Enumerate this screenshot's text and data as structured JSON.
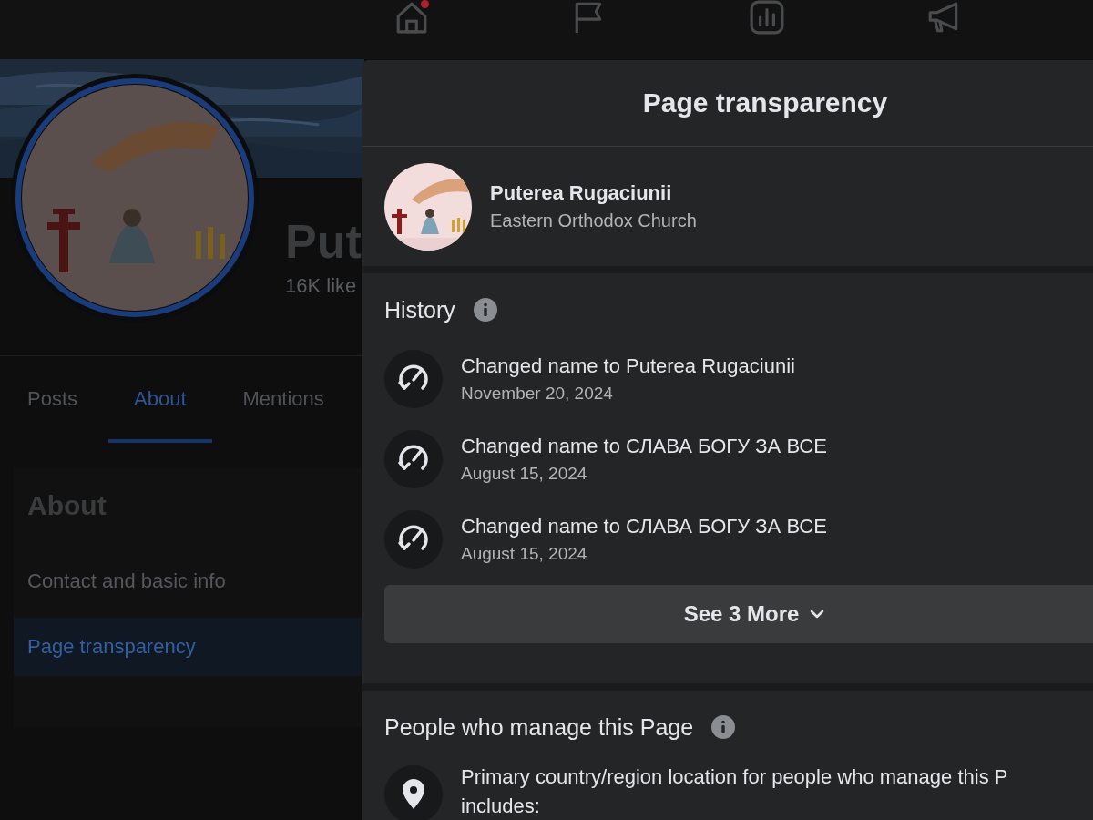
{
  "top_nav": {
    "items": [
      {
        "kind": "home",
        "notification": true
      },
      {
        "kind": "flag",
        "notification": false
      },
      {
        "kind": "chart",
        "notification": false
      },
      {
        "kind": "megaphone",
        "notification": false
      }
    ]
  },
  "page": {
    "name": "Put",
    "likes": "16K like",
    "tabs": [
      {
        "label": "Posts",
        "selected": false
      },
      {
        "label": "About",
        "selected": true
      },
      {
        "label": "Mentions",
        "selected": false
      }
    ],
    "about": {
      "heading": "About",
      "items": [
        {
          "label": "Contact and basic info",
          "selected": false
        },
        {
          "label": "Page transparency",
          "selected": true
        }
      ]
    }
  },
  "dialog": {
    "title": "Page transparency",
    "page": {
      "name": "Puterea Rugaciunii",
      "category": "Eastern Orthodox Church"
    },
    "history": {
      "title": "History",
      "items": [
        {
          "text": "Changed name to Puterea Rugaciunii",
          "date": "November 20, 2024"
        },
        {
          "text": "Changed name to СЛАВА БОГУ ЗА ВСЕ",
          "date": "August 15, 2024"
        },
        {
          "text": "Changed name to СЛАВА БОГУ ЗА ВСЕ",
          "date": "August 15, 2024"
        }
      ],
      "more_button": "See 3 More"
    },
    "managers": {
      "title": "People who manage this Page",
      "items": [
        {
          "text": "Primary country/region location for people who manage this P",
          "continuation": "includes:"
        }
      ]
    }
  }
}
